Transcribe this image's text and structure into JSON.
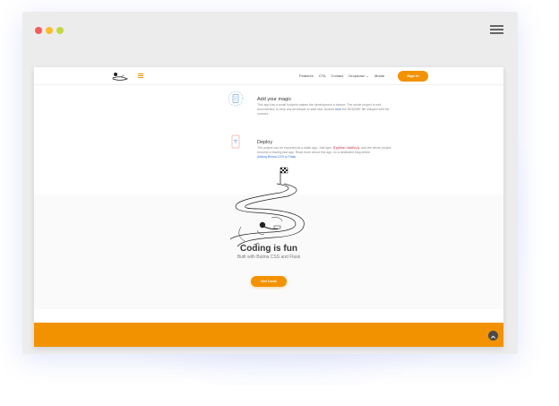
{
  "window": {
    "dots": [
      "#f75b5b",
      "#fbbd2e",
      "#c3d844"
    ]
  },
  "navbar": {
    "links": [
      "Features",
      "CTA",
      "Contact",
      "Dropdown ⌄",
      "Modal"
    ],
    "signin_label": "Sign in",
    "accent": "#f39200"
  },
  "features": [
    {
      "title": "Add your magic",
      "text_1": "This app has a small footprint makes the development a breeze. The whole project is well",
      "text_2a": "documented, to help any developer to start fast. Access ",
      "text_2_link": "here",
      "text_2b": " the README file shipped with the",
      "text_3": "sources."
    },
    {
      "title": "Deploy",
      "text_1a": "The project can be exported as a static app. Just type ",
      "text_1_code": "$ python .\\static.py",
      "text_1b": " and the whole project",
      "text_2": "become a blazing fast app. Read more about this app, on a dedicated blog article.",
      "link": "Adding Bulma CSS to Flask"
    }
  ],
  "hero": {
    "title": "Coding is fun",
    "subtitle": "Built with Bulma CSS and Flask",
    "cta_label": "Get Code"
  },
  "footer": {
    "color": "#f39200"
  }
}
